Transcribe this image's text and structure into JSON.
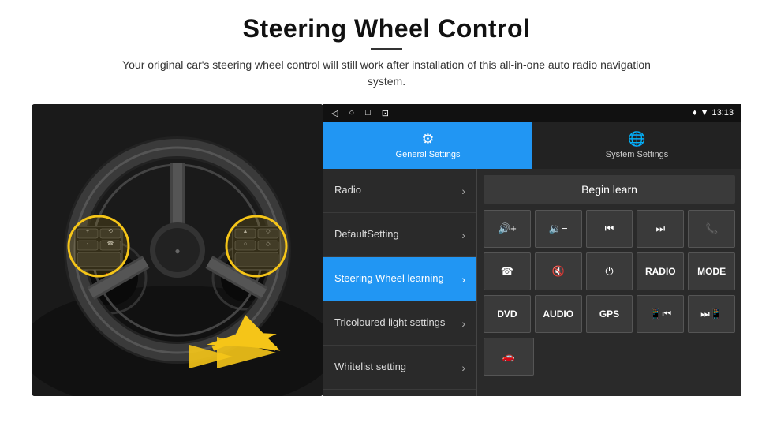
{
  "header": {
    "title": "Steering Wheel Control",
    "subtitle": "Your original car's steering wheel control will still work after installation of this all-in-one auto radio navigation system."
  },
  "status_bar": {
    "icons": [
      "◁",
      "○",
      "□",
      "⊡"
    ],
    "time": "13:13",
    "signal_icon": "♥ ▼"
  },
  "tabs": [
    {
      "id": "general",
      "label": "General Settings",
      "icon": "⚙",
      "active": true
    },
    {
      "id": "system",
      "label": "System Settings",
      "icon": "🌐",
      "active": false
    }
  ],
  "menu_items": [
    {
      "id": "radio",
      "label": "Radio",
      "active": false
    },
    {
      "id": "default",
      "label": "DefaultSetting",
      "active": false
    },
    {
      "id": "steering",
      "label": "Steering Wheel learning",
      "active": true
    },
    {
      "id": "tricoloured",
      "label": "Tricoloured light settings",
      "active": false
    },
    {
      "id": "whitelist",
      "label": "Whitelist setting",
      "active": false
    }
  ],
  "right_panel": {
    "begin_learn_label": "Begin learn",
    "controls_row1": [
      {
        "id": "vol-up",
        "icon": "🔊+",
        "label": "vol-up"
      },
      {
        "id": "vol-down",
        "icon": "🔉-",
        "label": "vol-down"
      },
      {
        "id": "prev",
        "icon": "⏮",
        "label": "prev-track"
      },
      {
        "id": "next",
        "icon": "⏭",
        "label": "next-track"
      },
      {
        "id": "phone",
        "icon": "📞",
        "label": "phone"
      }
    ],
    "controls_row2": [
      {
        "id": "hangup",
        "icon": "📵",
        "label": "hang-up"
      },
      {
        "id": "mute",
        "icon": "🔇",
        "label": "mute"
      },
      {
        "id": "power",
        "icon": "⏻",
        "label": "power"
      },
      {
        "id": "radio-btn",
        "text": "RADIO",
        "label": "radio-btn"
      },
      {
        "id": "mode-btn",
        "text": "MODE",
        "label": "mode-btn"
      }
    ],
    "controls_row3": [
      {
        "id": "dvd-btn",
        "text": "DVD",
        "label": "dvd-btn"
      },
      {
        "id": "audio-btn",
        "text": "AUDIO",
        "label": "audio-btn"
      },
      {
        "id": "gps-btn",
        "text": "GPS",
        "label": "gps-btn"
      },
      {
        "id": "phone-kbd",
        "icon": "📱⏮",
        "label": "phone-prev"
      },
      {
        "id": "arrow-btn",
        "icon": "⏭📱",
        "label": "phone-next"
      }
    ],
    "controls_row4": [
      {
        "id": "extra-btn",
        "icon": "🚗",
        "label": "car-icon"
      }
    ]
  }
}
